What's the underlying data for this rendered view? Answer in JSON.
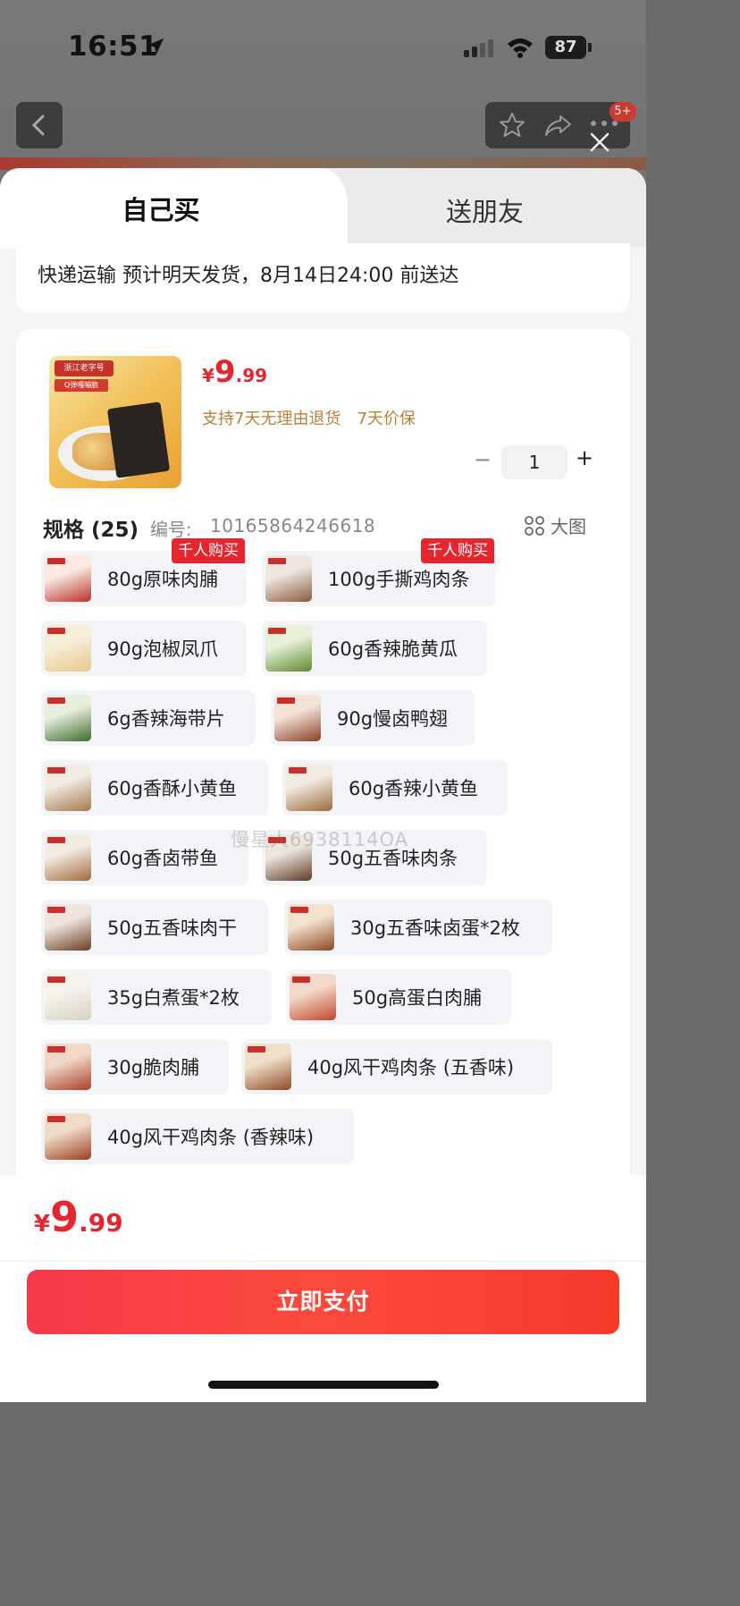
{
  "status_bar": {
    "time": "16:51",
    "battery": "87"
  },
  "header": {
    "badge": "5+"
  },
  "tabs": [
    {
      "label": "自己买",
      "active": true
    },
    {
      "label": "送朋友",
      "active": false
    }
  ],
  "delivery": {
    "text": "快递运输 预计明天发货，8月14日24:00 前送达"
  },
  "product": {
    "price_symbol": "¥",
    "price_int": "9",
    "price_dec": ".99",
    "guarantees": [
      "支持7天无理由退货",
      "7天价保"
    ],
    "quantity": "1",
    "image_brand": "浙江老字号",
    "image_slogan": "Q弹嘎嘣脆"
  },
  "spec": {
    "title": "规格 (25)",
    "code_label": "编号:",
    "code": "10165864246618",
    "bigview_label": "大图",
    "hot_tag": "千人购买",
    "watermark": "慢星人6938114OA",
    "options": [
      {
        "label": "80g原味肉脯",
        "hot": true,
        "colors": [
          "#fbe9e2",
          "#b8322a"
        ]
      },
      {
        "label": "100g手撕鸡肉条",
        "hot": true,
        "colors": [
          "#efe7df",
          "#8a5a3c"
        ]
      },
      {
        "label": "90g泡椒凤爪",
        "hot": false,
        "colors": [
          "#f6efd8",
          "#e6c88a"
        ]
      },
      {
        "label": "60g香辣脆黄瓜",
        "hot": false,
        "colors": [
          "#e8f0da",
          "#5c8a2c"
        ]
      },
      {
        "label": "6g香辣海带片",
        "hot": false,
        "colors": [
          "#e7eedd",
          "#3f6b2e"
        ]
      },
      {
        "label": "90g慢卤鸭翅",
        "hot": false,
        "colors": [
          "#f3e3d8",
          "#8b3f25"
        ]
      },
      {
        "label": "60g香酥小黄鱼",
        "hot": false,
        "colors": [
          "#f1ebe2",
          "#a47a4a"
        ]
      },
      {
        "label": "60g香辣小黄鱼",
        "hot": false,
        "colors": [
          "#f1ebe2",
          "#9a6a3a"
        ]
      },
      {
        "label": "60g香卤带鱼",
        "hot": false,
        "colors": [
          "#f2ece2",
          "#a06a3a"
        ]
      },
      {
        "label": "50g五香味肉条",
        "hot": false,
        "colors": [
          "#ede6de",
          "#5e3a22"
        ]
      },
      {
        "label": "50g五香味肉干",
        "hot": false,
        "colors": [
          "#efe5dc",
          "#6a3d22"
        ]
      },
      {
        "label": "30g五香味卤蛋*2枚",
        "hot": false,
        "colors": [
          "#f4e2cf",
          "#8a4a22"
        ]
      },
      {
        "label": "35g白煮蛋*2枚",
        "hot": false,
        "colors": [
          "#f6f2ea",
          "#d8d2c2"
        ]
      },
      {
        "label": "50g高蛋白肉脯",
        "hot": false,
        "colors": [
          "#f3d9c8",
          "#c2452c"
        ]
      },
      {
        "label": "30g脆肉脯",
        "hot": false,
        "colors": [
          "#f1d8c6",
          "#a8402a"
        ]
      },
      {
        "label": "40g风干鸡肉条 (五香味)",
        "hot": false,
        "colors": [
          "#f0dfc9",
          "#8e4a26"
        ]
      },
      {
        "label": "40g风干鸡肉条 (香辣味)",
        "hot": false,
        "colors": [
          "#f0dcc6",
          "#9a3f22"
        ]
      }
    ]
  },
  "footer": {
    "price_symbol": "¥",
    "price_int": "9",
    "price_dec": ".99",
    "pay_label": "立即支付"
  },
  "colors": {
    "accent": "#e6262f",
    "guarantee": "#b7823a",
    "hot_tag": "#e6262f"
  }
}
